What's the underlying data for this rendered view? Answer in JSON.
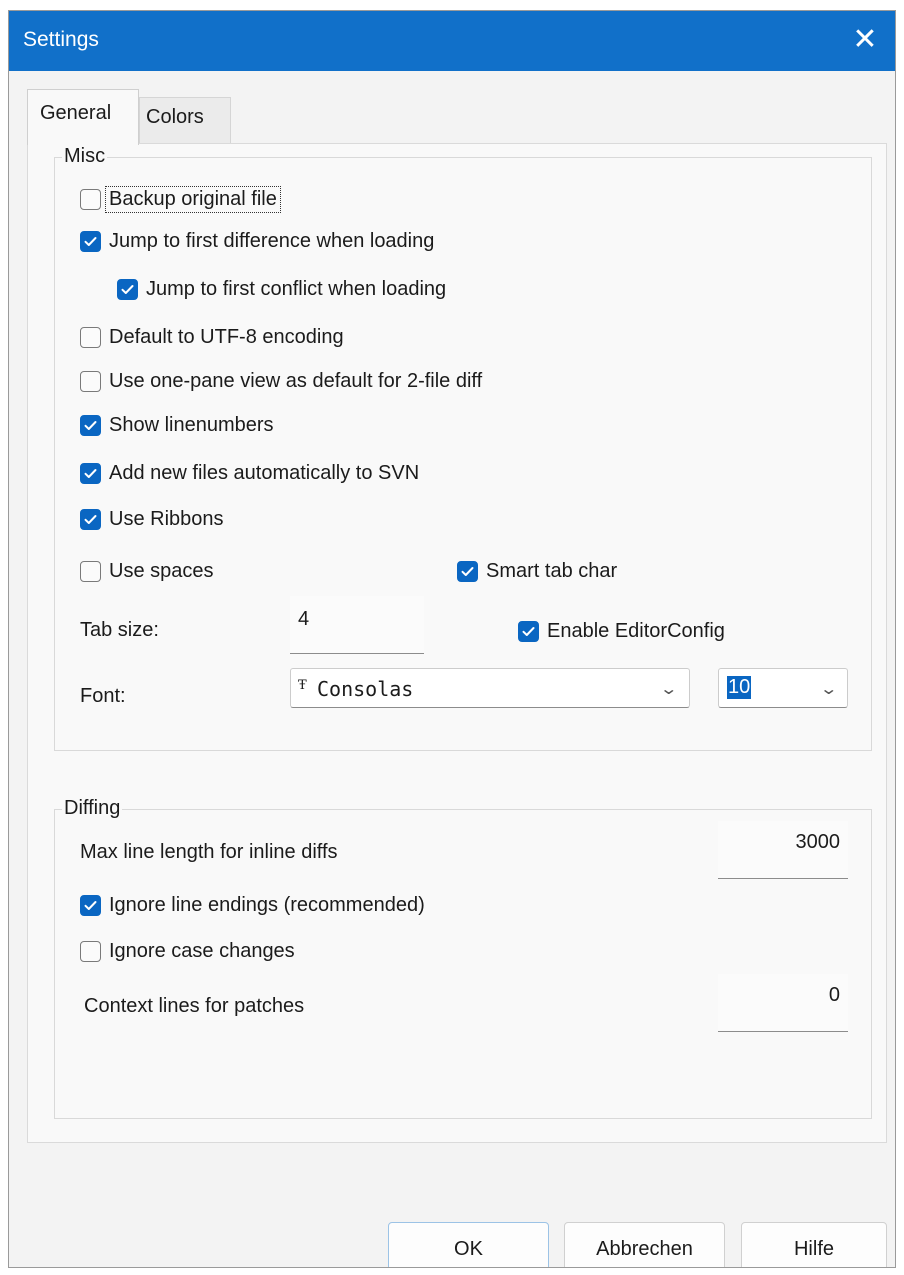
{
  "window": {
    "title": "Settings"
  },
  "tabs": [
    {
      "label": "General"
    },
    {
      "label": "Colors"
    }
  ],
  "misc": {
    "legend": "Misc",
    "options": {
      "backup": {
        "label": "Backup original file",
        "checked": false
      },
      "jump_difference": {
        "label": "Jump to first difference when loading",
        "checked": true
      },
      "jump_conflict": {
        "label": "Jump to first conflict when loading",
        "checked": true
      },
      "utf8": {
        "label": "Default to UTF-8 encoding",
        "checked": false
      },
      "one_pane": {
        "label": "Use one-pane view as default for 2-file diff",
        "checked": false
      },
      "linenumbers": {
        "label": "Show linenumbers",
        "checked": true
      },
      "svn": {
        "label": "Add new files automatically to SVN",
        "checked": true
      },
      "ribbons": {
        "label": "Use Ribbons",
        "checked": true
      },
      "spaces": {
        "label": "Use spaces",
        "checked": false
      },
      "smart_tab": {
        "label": "Smart tab char",
        "checked": true
      },
      "editorconfig": {
        "label": "Enable EditorConfig",
        "checked": true
      }
    },
    "tab_size": {
      "label": "Tab size:",
      "value": "4"
    },
    "font": {
      "label": "Font:",
      "family": "Consolas",
      "font_icon": "truetype-font-icon",
      "size": "10"
    }
  },
  "diffing": {
    "legend": "Diffing",
    "max_line": {
      "label": "Max line length for inline diffs",
      "value": "3000"
    },
    "options": {
      "line_endings": {
        "label": "Ignore line endings (recommended)",
        "checked": true
      },
      "case": {
        "label": "Ignore case changes",
        "checked": false
      }
    },
    "context_lines": {
      "label": "Context lines for patches",
      "value": "0"
    }
  },
  "buttons": {
    "ok": "OK",
    "cancel": "Abbrechen",
    "help": "Hilfe"
  },
  "colors": {
    "titlebar": "#1170c9",
    "checkbox_checked": "#0a66c2"
  }
}
